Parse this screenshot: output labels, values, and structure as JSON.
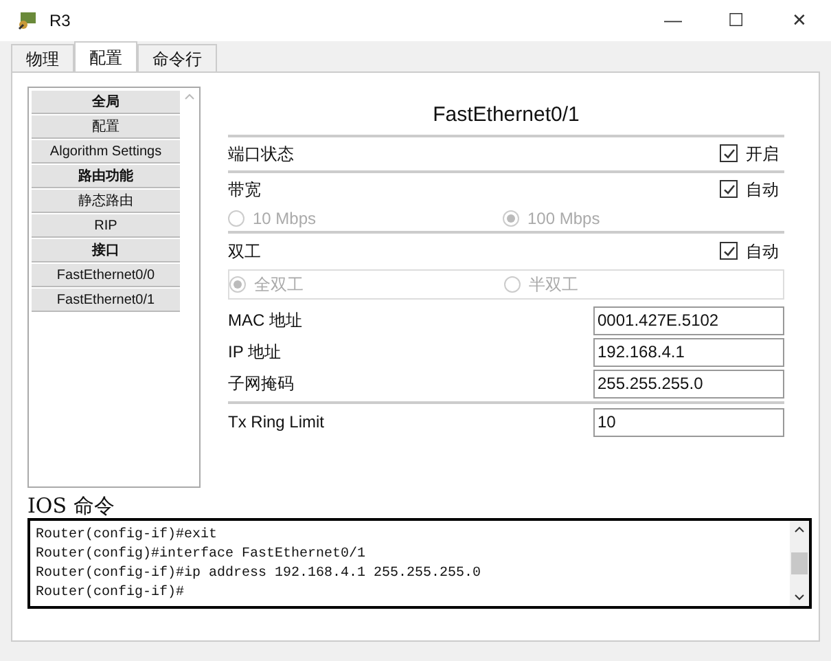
{
  "window": {
    "title": "R3",
    "controls": [
      "—",
      "☐",
      "✕"
    ]
  },
  "tabs": [
    {
      "label": "物理",
      "selected": false
    },
    {
      "label": "配置",
      "selected": true
    },
    {
      "label": "命令行",
      "selected": false
    }
  ],
  "sidebar": {
    "items": [
      {
        "label": "全局",
        "kind": "header"
      },
      {
        "label": "配置",
        "kind": "item"
      },
      {
        "label": "Algorithm Settings",
        "kind": "item"
      },
      {
        "label": "路由功能",
        "kind": "header"
      },
      {
        "label": "静态路由",
        "kind": "item"
      },
      {
        "label": "RIP",
        "kind": "item"
      },
      {
        "label": "接口",
        "kind": "header"
      },
      {
        "label": "FastEthernet0/0",
        "kind": "item"
      },
      {
        "label": "FastEthernet0/1",
        "kind": "item"
      }
    ]
  },
  "panel": {
    "title": "FastEthernet0/1",
    "port_status": {
      "label": "端口状态",
      "checkbox": {
        "label": "开启",
        "checked": true
      }
    },
    "bandwidth": {
      "label": "带宽",
      "checkbox": {
        "label": "自动",
        "checked": true
      },
      "options": [
        {
          "label": "10 Mbps",
          "selected": false
        },
        {
          "label": "100 Mbps",
          "selected": true
        }
      ]
    },
    "duplex": {
      "label": "双工",
      "checkbox": {
        "label": "自动",
        "checked": true
      },
      "options": [
        {
          "label": "全双工",
          "selected": true
        },
        {
          "label": "半双工",
          "selected": false
        }
      ]
    },
    "fields": [
      {
        "label": "MAC 地址",
        "value": "0001.427E.5102"
      },
      {
        "label": "IP 地址",
        "value": "192.168.4.1"
      },
      {
        "label": "子网掩码",
        "value": "255.255.255.0"
      }
    ],
    "tx_ring": {
      "label": "Tx Ring Limit",
      "value": "10"
    }
  },
  "ios": {
    "title": "IOS 命令",
    "lines": [
      "Router(config-if)#exit",
      "Router(config)#interface FastEthernet0/1",
      "Router(config-if)#ip address 192.168.4.1 255.255.255.0",
      "Router(config-if)#"
    ]
  }
}
